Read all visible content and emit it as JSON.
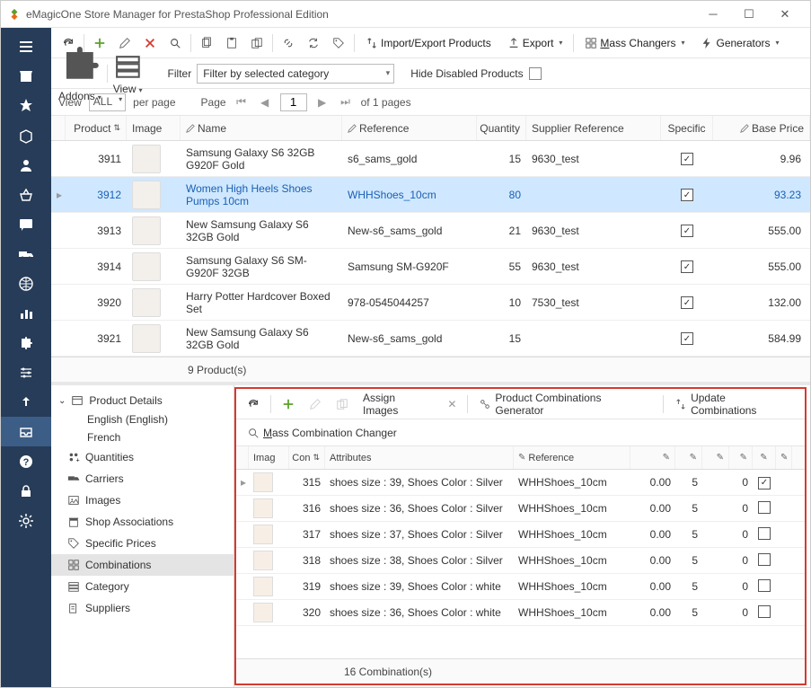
{
  "window": {
    "title": "eMagicOne Store Manager for PrestaShop Professional Edition"
  },
  "toolbar": {
    "import_export": "Import/Export Products",
    "export": "Export",
    "mass_changers": "Mass Changers",
    "generators": "Generators"
  },
  "filterbar": {
    "addons": "Addons",
    "view": "View",
    "filter_label": "Filter",
    "filter_value": "Filter by selected category",
    "hide_disabled": "Hide Disabled Products"
  },
  "pager": {
    "view_label": "View",
    "all": "ALL",
    "per_page": "per page",
    "page_label": "Page",
    "page_value": "1",
    "of_pages": "of 1 pages"
  },
  "grid": {
    "headers": {
      "product": "Product",
      "image": "Image",
      "name": "Name",
      "reference": "Reference",
      "quantity": "Quantity",
      "supplier_ref": "Supplier Reference",
      "specific": "Specific",
      "base_price": "Base Price"
    },
    "rows": [
      {
        "product": "3911",
        "name": "Samsung Galaxy S6 32GB G920F Gold",
        "reference": "s6_sams_gold",
        "quantity": "15",
        "supplier_ref": "9630_test",
        "specific": true,
        "base_price": "9.96"
      },
      {
        "product": "3912",
        "name": "Women High Heels Shoes Pumps 10cm",
        "reference": "WHHShoes_10cm",
        "quantity": "80",
        "supplier_ref": "",
        "specific": true,
        "base_price": "93.23",
        "selected": true
      },
      {
        "product": "3913",
        "name": "New Samsung Galaxy S6 32GB Gold",
        "reference": "New-s6_sams_gold",
        "quantity": "21",
        "supplier_ref": "9630_test",
        "specific": true,
        "base_price": "555.00"
      },
      {
        "product": "3914",
        "name": "Samsung Galaxy S6 SM-G920F 32GB",
        "reference": "Samsung SM-G920F",
        "quantity": "55",
        "supplier_ref": "9630_test",
        "specific": true,
        "base_price": "555.00"
      },
      {
        "product": "3920",
        "name": "Harry Potter Hardcover Boxed Set",
        "reference": "978-0545044257",
        "quantity": "10",
        "supplier_ref": "7530_test",
        "specific": true,
        "base_price": "132.00"
      },
      {
        "product": "3921",
        "name": "New Samsung Galaxy S6 32GB Gold",
        "reference": "New-s6_sams_gold",
        "quantity": "15",
        "supplier_ref": "",
        "specific": true,
        "base_price": "584.99"
      }
    ],
    "footer": "9 Product(s)"
  },
  "details": {
    "header": "Product Details",
    "langs": [
      "English (English)",
      "French"
    ],
    "items": {
      "quantities": "Quantities",
      "carriers": "Carriers",
      "images": "Images",
      "shop_assoc": "Shop Associations",
      "specific_prices": "Specific Prices",
      "combinations": "Combinations",
      "category": "Category",
      "suppliers": "Suppliers"
    }
  },
  "comb_toolbar": {
    "assign_images": "Assign Images",
    "combo_gen": "Product Combinations Generator",
    "update_comb": "Update Combinations",
    "mass_changer": "Mass Combination Changer"
  },
  "comb_grid": {
    "headers": {
      "imag": "Imag",
      "con": "Con",
      "attributes": "Attributes",
      "reference": "Reference"
    },
    "rows": [
      {
        "con": "315",
        "attr": "shoes size : 39, Shoes Color : Silver",
        "ref": "WHHShoes_10cm",
        "n1": "0.00",
        "n2": "5",
        "n3": "0",
        "chk": true
      },
      {
        "con": "316",
        "attr": "shoes size : 36, Shoes Color : Silver",
        "ref": "WHHShoes_10cm",
        "n1": "0.00",
        "n2": "5",
        "n3": "0",
        "chk": false
      },
      {
        "con": "317",
        "attr": "shoes size : 37, Shoes Color : Silver",
        "ref": "WHHShoes_10cm",
        "n1": "0.00",
        "n2": "5",
        "n3": "0",
        "chk": false
      },
      {
        "con": "318",
        "attr": "shoes size : 38, Shoes Color : Silver",
        "ref": "WHHShoes_10cm",
        "n1": "0.00",
        "n2": "5",
        "n3": "0",
        "chk": false
      },
      {
        "con": "319",
        "attr": "shoes size : 39, Shoes Color : white",
        "ref": "WHHShoes_10cm",
        "n1": "0.00",
        "n2": "5",
        "n3": "0",
        "chk": false
      },
      {
        "con": "320",
        "attr": "shoes size : 36, Shoes Color : white",
        "ref": "WHHShoes_10cm",
        "n1": "0.00",
        "n2": "5",
        "n3": "0",
        "chk": false
      }
    ],
    "footer": "16 Combination(s)"
  }
}
